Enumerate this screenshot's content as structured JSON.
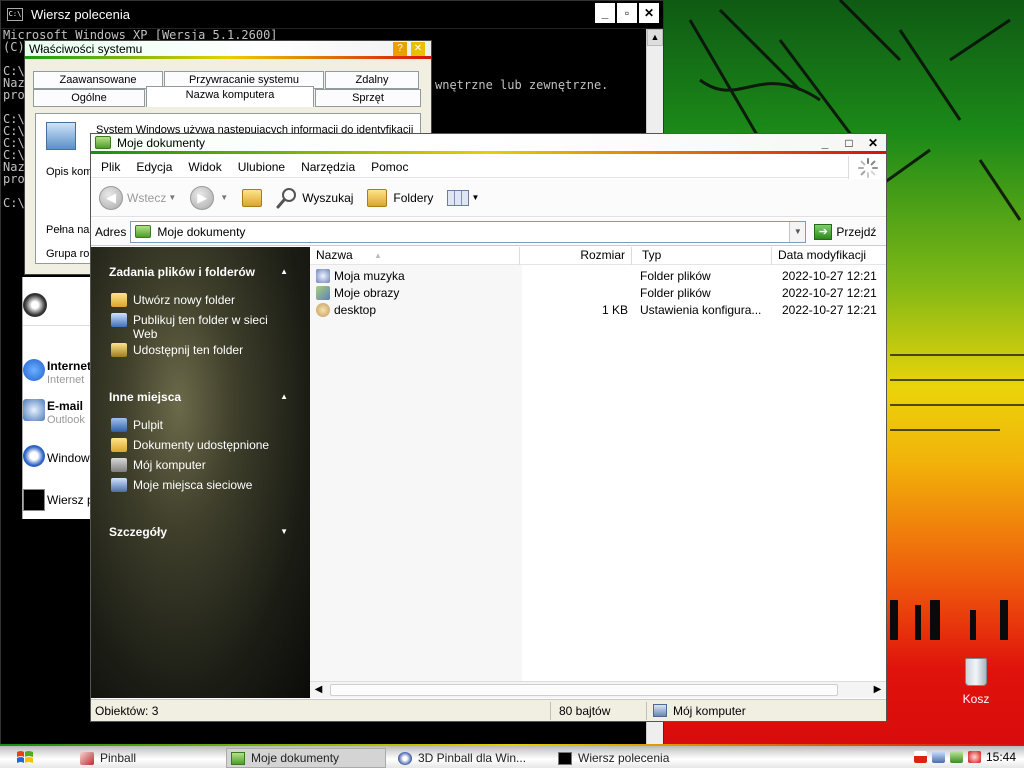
{
  "colors": {
    "accent_green": "#148f14",
    "accent_yellow": "#e6d000",
    "accent_red": "#d61010",
    "task_pane_dark": "#1b1d15"
  },
  "console": {
    "title": "Wiersz polecenia",
    "line1": "Microsoft Windows XP [Wersja 5.1.2600]",
    "line2": "(C) Copyright 1985-2001 Microsoft Corp.",
    "fragment_right": "wnętrzne lub zewnętrzne.",
    "prompt_lines": [
      "C:\\",
      "Naz",
      "pro",
      "",
      "C:\\",
      "C:\\",
      "C:\\",
      "C:\\",
      "Naz",
      "pro",
      "",
      "C:\\"
    ]
  },
  "sysprops": {
    "title": "Właściwości systemu",
    "tabs_back": [
      "Zaawansowane",
      "Przywracanie systemu",
      "Zdalny"
    ],
    "tabs_front": [
      "Ogólne",
      "Nazwa komputera",
      "Sprzęt"
    ],
    "active_tab": "Nazwa komputera",
    "text_line": "System Windows używa następujących informacji do identyfikacji",
    "label_opis": "Opis kom",
    "label_pelna": "Pełna na",
    "label_grupa": "Grupa ro"
  },
  "startmenu_fragment": {
    "internet_title": "Internet",
    "internet_sub": "Internet",
    "email_title": "E-mail",
    "email_sub": "Outlook",
    "windows_item": "Window",
    "cmd_item": "Wiersz p"
  },
  "explorer": {
    "title": "Moje dokumenty",
    "menu": [
      "Plik",
      "Edycja",
      "Widok",
      "Ulubione",
      "Narzędzia",
      "Pomoc"
    ],
    "toolbar": {
      "back_label": "Wstecz",
      "search_label": "Wyszukaj",
      "folders_label": "Foldery"
    },
    "address": {
      "label": "Adres",
      "value": "Moje dokumenty",
      "go_label": "Przejdź"
    },
    "tasks": {
      "file_tasks_header": "Zadania plików i folderów",
      "file_tasks": [
        "Utwórz nowy folder",
        "Publikuj ten folder w sieci Web",
        "Udostępnij ten folder"
      ],
      "other_places_header": "Inne miejsca",
      "other_places": [
        "Pulpit",
        "Dokumenty udostępnione",
        "Mój komputer",
        "Moje miejsca sieciowe"
      ],
      "details_header": "Szczegóły"
    },
    "columns": [
      "Nazwa",
      "Rozmiar",
      "Typ",
      "Data modyfikacji"
    ],
    "files": [
      {
        "name": "Moja muzyka",
        "size": "",
        "type": "Folder plików",
        "date": "2022-10-27 12:21"
      },
      {
        "name": "Moje obrazy",
        "size": "",
        "type": "Folder plików",
        "date": "2022-10-27 12:21"
      },
      {
        "name": "desktop",
        "size": "1 KB",
        "type": "Ustawienia konfigura...",
        "date": "2022-10-27 12:21"
      }
    ],
    "status": {
      "objects": "Obiektów: 3",
      "size": "80 bajtów",
      "location": "Mój komputer"
    }
  },
  "desktop": {
    "recycle_label": "Kosz"
  },
  "taskbar": {
    "tasks": [
      "Pinball",
      "Moje dokumenty",
      "3D Pinball dla Win...",
      "Wiersz polecenia"
    ],
    "active_task": "Moje dokumenty",
    "clock": "15:44"
  }
}
